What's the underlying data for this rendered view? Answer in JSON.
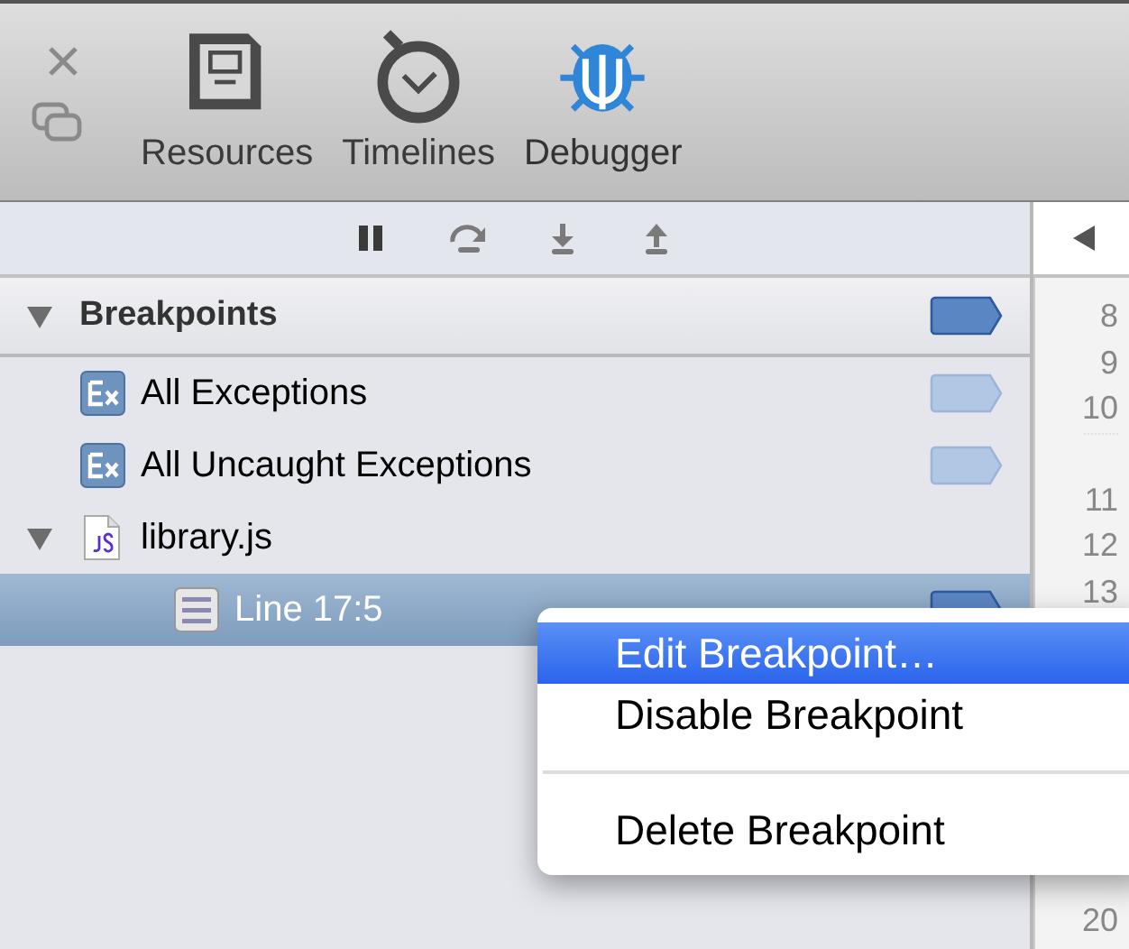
{
  "toolbar": {
    "tabs": [
      {
        "label": "Resources",
        "kind": "resources",
        "selected": false
      },
      {
        "label": "Timelines",
        "kind": "timelines",
        "selected": false
      },
      {
        "label": "Debugger",
        "kind": "debugger",
        "selected": true
      }
    ]
  },
  "debug_controls": [
    {
      "kind": "pause"
    },
    {
      "kind": "step-over"
    },
    {
      "kind": "step-into"
    },
    {
      "kind": "step-out"
    }
  ],
  "sidebar": {
    "section": {
      "title": "Breakpoints",
      "expanded": true,
      "active": true
    },
    "items": [
      {
        "label": "All Exceptions",
        "kind": "exception",
        "active": false,
        "selected": false
      },
      {
        "label": "All Uncaught Exceptions",
        "kind": "exception",
        "active": false,
        "selected": false
      },
      {
        "label": "library.js",
        "kind": "file",
        "expanded": true,
        "selected": false,
        "children": [
          {
            "label": "Line 17:5",
            "kind": "line",
            "active": true,
            "selected": true
          }
        ]
      }
    ]
  },
  "gutter": {
    "lines": [
      {
        "text": "8"
      },
      {
        "text": "9"
      },
      {
        "text": "10"
      },
      {
        "text": "11",
        "after_wrap": true
      },
      {
        "text": "12"
      },
      {
        "text": "13"
      },
      {
        "text": "20",
        "at_bottom": true
      }
    ]
  },
  "context_menu": {
    "items": [
      {
        "label": "Edit Breakpoint…",
        "kind": "item",
        "selected": true
      },
      {
        "label": "Disable Breakpoint",
        "kind": "item",
        "selected": false
      },
      {
        "kind": "separator"
      },
      {
        "label": "Delete Breakpoint",
        "kind": "item",
        "selected": false
      }
    ]
  }
}
